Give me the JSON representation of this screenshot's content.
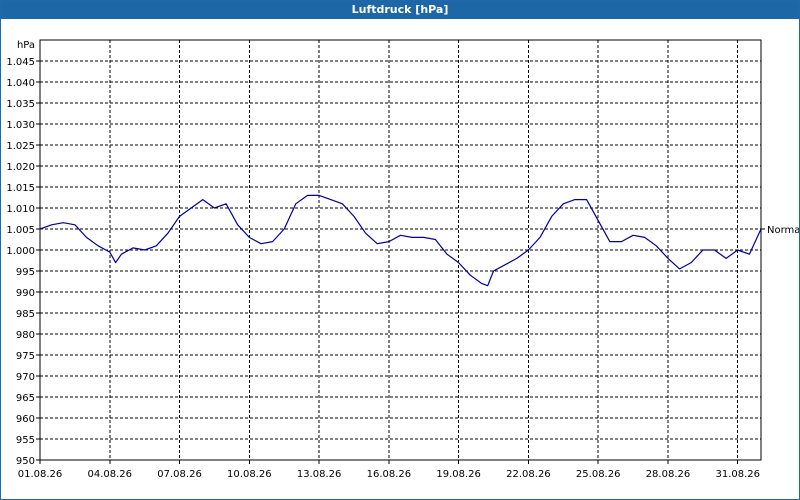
{
  "window": {
    "title": "Luftdruck [hPa]"
  },
  "colors": {
    "titlebar": "#1e67a7",
    "series": "#0000a0",
    "grid": "#000000"
  },
  "chart_data": {
    "type": "line",
    "title": "Luftdruck [hPa]",
    "ylabel": "hPa",
    "xlabel": "",
    "ylim": [
      950,
      1050
    ],
    "yticks": [
      950,
      955,
      960,
      965,
      970,
      975,
      980,
      985,
      990,
      995,
      1000,
      1005,
      1010,
      1015,
      1020,
      1025,
      1030,
      1035,
      1040,
      1045
    ],
    "ytick_labels": [
      "950",
      "955",
      "960",
      "965",
      "970",
      "975",
      "980",
      "985",
      "990",
      "995",
      "1.000",
      "1.005",
      "1.010",
      "1.015",
      "1.020",
      "1.025",
      "1.030",
      "1.035",
      "1.040",
      "1.045"
    ],
    "xlim": [
      "01.08.26",
      "01.09.26"
    ],
    "xtick_labels": [
      "01.08.26",
      "04.08.26",
      "07.08.26",
      "10.08.26",
      "13.08.26",
      "16.08.26",
      "19.08.26",
      "22.08.26",
      "25.08.26",
      "28.08.26",
      "31.08.26"
    ],
    "grid": true,
    "legend": "none",
    "series": [
      {
        "name": "Normal",
        "label_position": "right-end",
        "x": [
          "01.08.26 00:00",
          "01.08.26 12:00",
          "02.08.26 00:00",
          "02.08.26 12:00",
          "03.08.26 00:00",
          "03.08.26 12:00",
          "04.08.26 00:00",
          "04.08.26 06:00",
          "04.08.26 12:00",
          "05.08.26 00:00",
          "05.08.26 12:00",
          "06.08.26 00:00",
          "06.08.26 12:00",
          "07.08.26 00:00",
          "07.08.26 12:00",
          "08.08.26 00:00",
          "08.08.26 12:00",
          "09.08.26 00:00",
          "09.08.26 12:00",
          "10.08.26 00:00",
          "10.08.26 12:00",
          "11.08.26 00:00",
          "11.08.26 12:00",
          "12.08.26 00:00",
          "12.08.26 12:00",
          "13.08.26 00:00",
          "13.08.26 12:00",
          "14.08.26 00:00",
          "14.08.26 12:00",
          "15.08.26 00:00",
          "15.08.26 12:00",
          "16.08.26 00:00",
          "16.08.26 12:00",
          "17.08.26 00:00",
          "17.08.26 12:00",
          "18.08.26 00:00",
          "18.08.26 12:00",
          "19.08.26 00:00",
          "19.08.26 12:00",
          "20.08.26 00:00",
          "20.08.26 06:00",
          "20.08.26 12:00",
          "21.08.26 00:00",
          "21.08.26 12:00",
          "22.08.26 00:00",
          "22.08.26 12:00",
          "23.08.26 00:00",
          "23.08.26 12:00",
          "24.08.26 00:00",
          "24.08.26 12:00",
          "25.08.26 00:00",
          "25.08.26 12:00",
          "26.08.26 00:00",
          "26.08.26 12:00",
          "27.08.26 00:00",
          "27.08.26 12:00",
          "28.08.26 00:00",
          "28.08.26 12:00",
          "29.08.26 00:00",
          "29.08.26 12:00",
          "30.08.26 00:00",
          "30.08.26 12:00",
          "31.08.26 00:00",
          "31.08.26 12:00",
          "01.09.26 00:00"
        ],
        "y": [
          1005,
          1006,
          1006.5,
          1006,
          1003,
          1001,
          999.5,
          997,
          999,
          1000.5,
          1000,
          1001,
          1004,
          1008,
          1010,
          1012,
          1010,
          1011,
          1006,
          1003,
          1001.5,
          1002,
          1005,
          1011,
          1013,
          1013,
          1012,
          1011,
          1008,
          1004,
          1001.5,
          1002,
          1003.5,
          1003,
          1003,
          1002.5,
          999,
          997,
          994,
          992,
          991.5,
          995,
          996.5,
          998,
          1000,
          1003,
          1008,
          1011,
          1012,
          1012,
          1007,
          1002,
          1002,
          1003.5,
          1003,
          1001,
          998,
          995.5,
          997,
          1000,
          1000,
          998,
          1000,
          999,
          1005
        ]
      }
    ]
  }
}
